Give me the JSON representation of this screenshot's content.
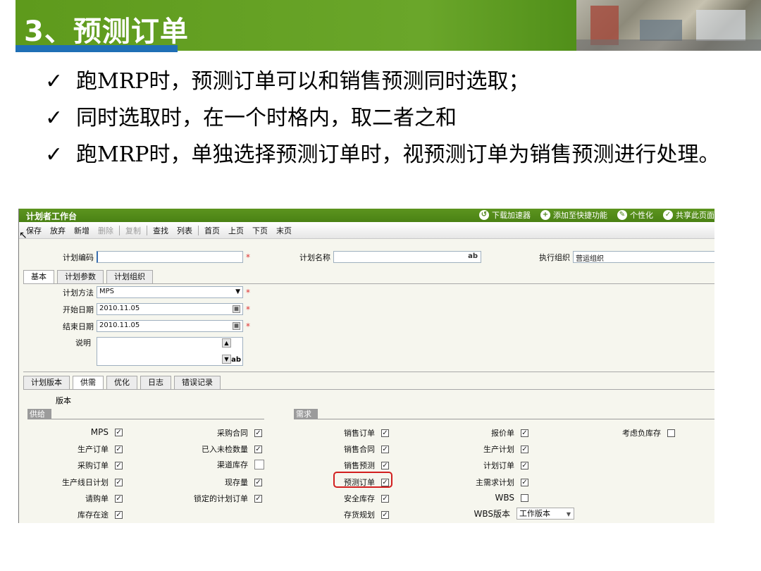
{
  "slide": {
    "title": "3、预测订单",
    "bullets": [
      "跑MRP时，预测订单可以和销售预测同时选取；",
      "同时选取时，在一个时格内，取二者之和",
      "跑MRP时，单独选择预测订单时，视预测订单为销售预测进行处理。"
    ],
    "check_glyph": "✓"
  },
  "app": {
    "title": "计划者工作台",
    "header_links": [
      "下载加速器",
      "添加至快捷功能",
      "个性化",
      "共享此页面"
    ],
    "toolbar": {
      "items": [
        {
          "label": "保存",
          "enabled": true
        },
        {
          "label": "放弃",
          "enabled": true
        },
        {
          "label": "新增",
          "enabled": true
        },
        {
          "label": "删除",
          "enabled": false
        },
        {
          "label": "复制",
          "enabled": false
        },
        {
          "label": "查找",
          "enabled": true
        },
        {
          "label": "列表",
          "enabled": true
        },
        {
          "label": "首页",
          "enabled": true
        },
        {
          "label": "上页",
          "enabled": true
        },
        {
          "label": "下页",
          "enabled": true
        },
        {
          "label": "末页",
          "enabled": true
        }
      ]
    },
    "header_fields": {
      "plan_code_label": "计划编码",
      "plan_code_value": "",
      "plan_name_label": "计划名称",
      "plan_name_value": "",
      "org_label": "执行组织",
      "org_value": "营运组织",
      "required_mark": "*",
      "ab_mark": "ab"
    },
    "tabs_top": [
      "基本",
      "计划参数",
      "计划组织"
    ],
    "basic": {
      "method_label": "计划方法",
      "method_value": "MPS",
      "start_label": "开始日期",
      "start_value": "2010.11.05",
      "end_label": "结束日期",
      "end_value": "2010.11.05",
      "desc_label": "说明",
      "desc_value": ""
    },
    "tabs_bottom": [
      "计划版本",
      "供需",
      "优化",
      "日志",
      "错误记录"
    ],
    "version_label": "版本",
    "supply_header": "供给",
    "demand_header": "需求",
    "supply_col1": [
      {
        "label": "MPS",
        "checked": true
      },
      {
        "label": "生产订单",
        "checked": true
      },
      {
        "label": "采购订单",
        "checked": true
      },
      {
        "label": "生产线日计划",
        "checked": true
      },
      {
        "label": "请购单",
        "checked": true
      },
      {
        "label": "库存在途",
        "checked": true
      }
    ],
    "supply_col2": [
      {
        "label": "采购合同",
        "checked": true
      },
      {
        "label": "已入未检数量",
        "checked": true
      },
      {
        "label": "渠道库存",
        "checked": false
      },
      {
        "label": "现存量",
        "checked": true
      },
      {
        "label": "锁定的计划订单",
        "checked": true
      }
    ],
    "demand_col1": [
      {
        "label": "销售订单",
        "checked": true
      },
      {
        "label": "销售合同",
        "checked": true
      },
      {
        "label": "销售预测",
        "checked": true
      },
      {
        "label": "预测订单",
        "checked": true
      },
      {
        "label": "安全库存",
        "checked": true
      },
      {
        "label": "存货规划",
        "checked": true
      }
    ],
    "demand_col2": [
      {
        "label": "报价单",
        "checked": true
      },
      {
        "label": "生产计划",
        "checked": true
      },
      {
        "label": "计划订单",
        "checked": true
      },
      {
        "label": "主需求计划",
        "checked": true
      },
      {
        "label": "WBS",
        "checked": false
      },
      {
        "label": "WBS版本",
        "checked": false
      }
    ],
    "demand_col3": [
      {
        "label": "考虑负库存",
        "checked": false
      }
    ],
    "wbs_version_value": "工作版本",
    "highlight_color": "#d21f1f",
    "brand_green": "#5d951f"
  }
}
